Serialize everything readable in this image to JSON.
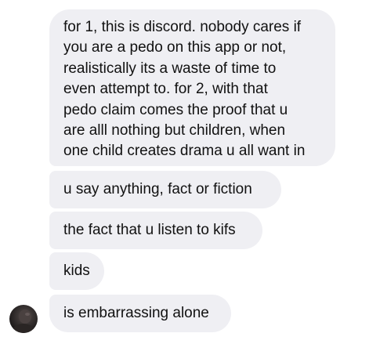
{
  "messages": [
    {
      "lines": [
        "for 1, this is discord. nobody cares if",
        "you are a pedo on this app or not,",
        "realistically its a waste of time to",
        "even attempt to. for 2, with that",
        "pedo claim comes the proof that u",
        "are alll nothing but children, when",
        "one child creates drama u all want in"
      ]
    },
    {
      "text": "u say anything, fact or fiction"
    },
    {
      "text": "the fact that u listen to kifs"
    },
    {
      "text": "kids"
    },
    {
      "text": "is embarrassing alone"
    }
  ],
  "sender": {
    "avatar_icon": "profile-photo"
  },
  "colors": {
    "bubble": "#efeff3",
    "text": "#111111",
    "background": "#ffffff"
  }
}
